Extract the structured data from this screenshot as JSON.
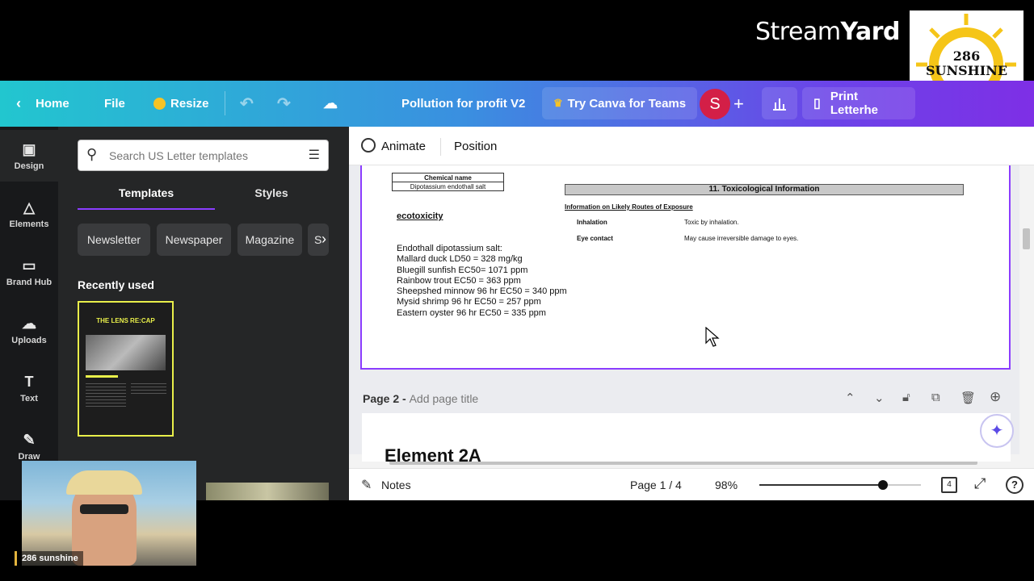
{
  "overlay": {
    "brand_prefix": "Stream",
    "brand_suffix": "Yard",
    "logo_line1": "286",
    "logo_line2": "SUNSHINE",
    "cam_label": "286 sunshine"
  },
  "topbar": {
    "home": "Home",
    "file": "File",
    "resize": "Resize",
    "doc_title": "Pollution for profit V2",
    "try_teams": "Try Canva for Teams",
    "avatar_letter": "S",
    "print": "Print Letterhe"
  },
  "rail": [
    {
      "label": "Design",
      "icon": "▣"
    },
    {
      "label": "Elements",
      "icon": "△"
    },
    {
      "label": "Brand Hub",
      "icon": "▭"
    },
    {
      "label": "Uploads",
      "icon": "☁"
    },
    {
      "label": "Text",
      "icon": "T"
    },
    {
      "label": "Draw",
      "icon": "✎"
    }
  ],
  "panel": {
    "search_placeholder": "Search US Letter templates",
    "tab_templates": "Templates",
    "tab_styles": "Styles",
    "chips": [
      "Newsletter",
      "Newspaper",
      "Magazine",
      "S"
    ],
    "recent_heading": "Recently used",
    "thumb_title": "THE LENS RE:CAP"
  },
  "editor": {
    "animate": "Animate",
    "position": "Position"
  },
  "doc": {
    "chem_header": "Chemical name",
    "chem_value": "Dipotassium endothall salt",
    "section_title": "11. Toxicological Information",
    "routes_heading": "Information on Likely Routes of Exposure",
    "inhalation_label": "Inhalation",
    "inhalation_value": "Toxic by inhalation.",
    "eye_label": "Eye contact",
    "eye_value": "May cause irreversible damage to eyes.",
    "ecotox": "ecotoxicity",
    "lines": [
      "Endothall dipotassium salt:",
      "Mallard duck LD50 = 328 mg/kg",
      "Bluegill sunfish EC50= 1071 ppm",
      "Rainbow trout EC50 = 363 ppm",
      "Sheepshed minnow 96 hr EC50 = 340 ppm",
      "Mysid shrimp 96 hr EC50 = 257 ppm",
      "Eastern oyster 96 hr EC50 = 335 ppm"
    ]
  },
  "page2": {
    "label": "Page 2 - ",
    "placeholder": "Add page title",
    "peek_text": "Element 2A"
  },
  "bottom": {
    "notes": "Notes",
    "page_indicator": "Page 1 / 4",
    "zoom": "98%",
    "zoom_level_pct": 98,
    "page_count": "4"
  },
  "colors": {
    "accent": "#8b3dff",
    "avatar": "#d31f47",
    "crown": "#f7c325"
  }
}
